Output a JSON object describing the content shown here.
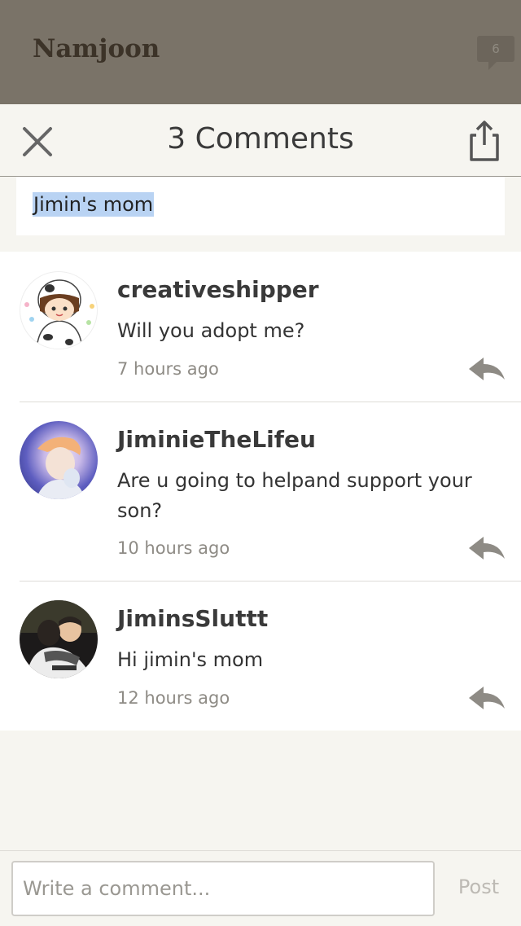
{
  "story": {
    "title": "Namjoon",
    "comment_badge": "6"
  },
  "header": {
    "title": "3 Comments",
    "close_icon": "close-icon",
    "share_icon": "share-icon"
  },
  "quote": {
    "text": "Jimin's mom"
  },
  "comments": [
    {
      "username": "creativeshipper",
      "text": "Will you adopt me?",
      "time": "7 hours ago",
      "avatar": "cow-costume-cartoon-avatar"
    },
    {
      "username": "JiminieTheLifeu",
      "text": "Are u going to helpand support  your son?",
      "time": "10 hours ago",
      "avatar": "photo-avatar-blue"
    },
    {
      "username": "JiminsSluttt",
      "text": "Hi jimin's mom",
      "time": "12 hours ago",
      "avatar": "photo-avatar-dark"
    }
  ],
  "composer": {
    "placeholder": "Write a comment...",
    "post_label": "Post"
  },
  "colors": {
    "top_bar": "#7a7368",
    "background": "#f6f5f0",
    "highlight": "#b9d3f3",
    "icon_gray": "#8e8b85"
  }
}
